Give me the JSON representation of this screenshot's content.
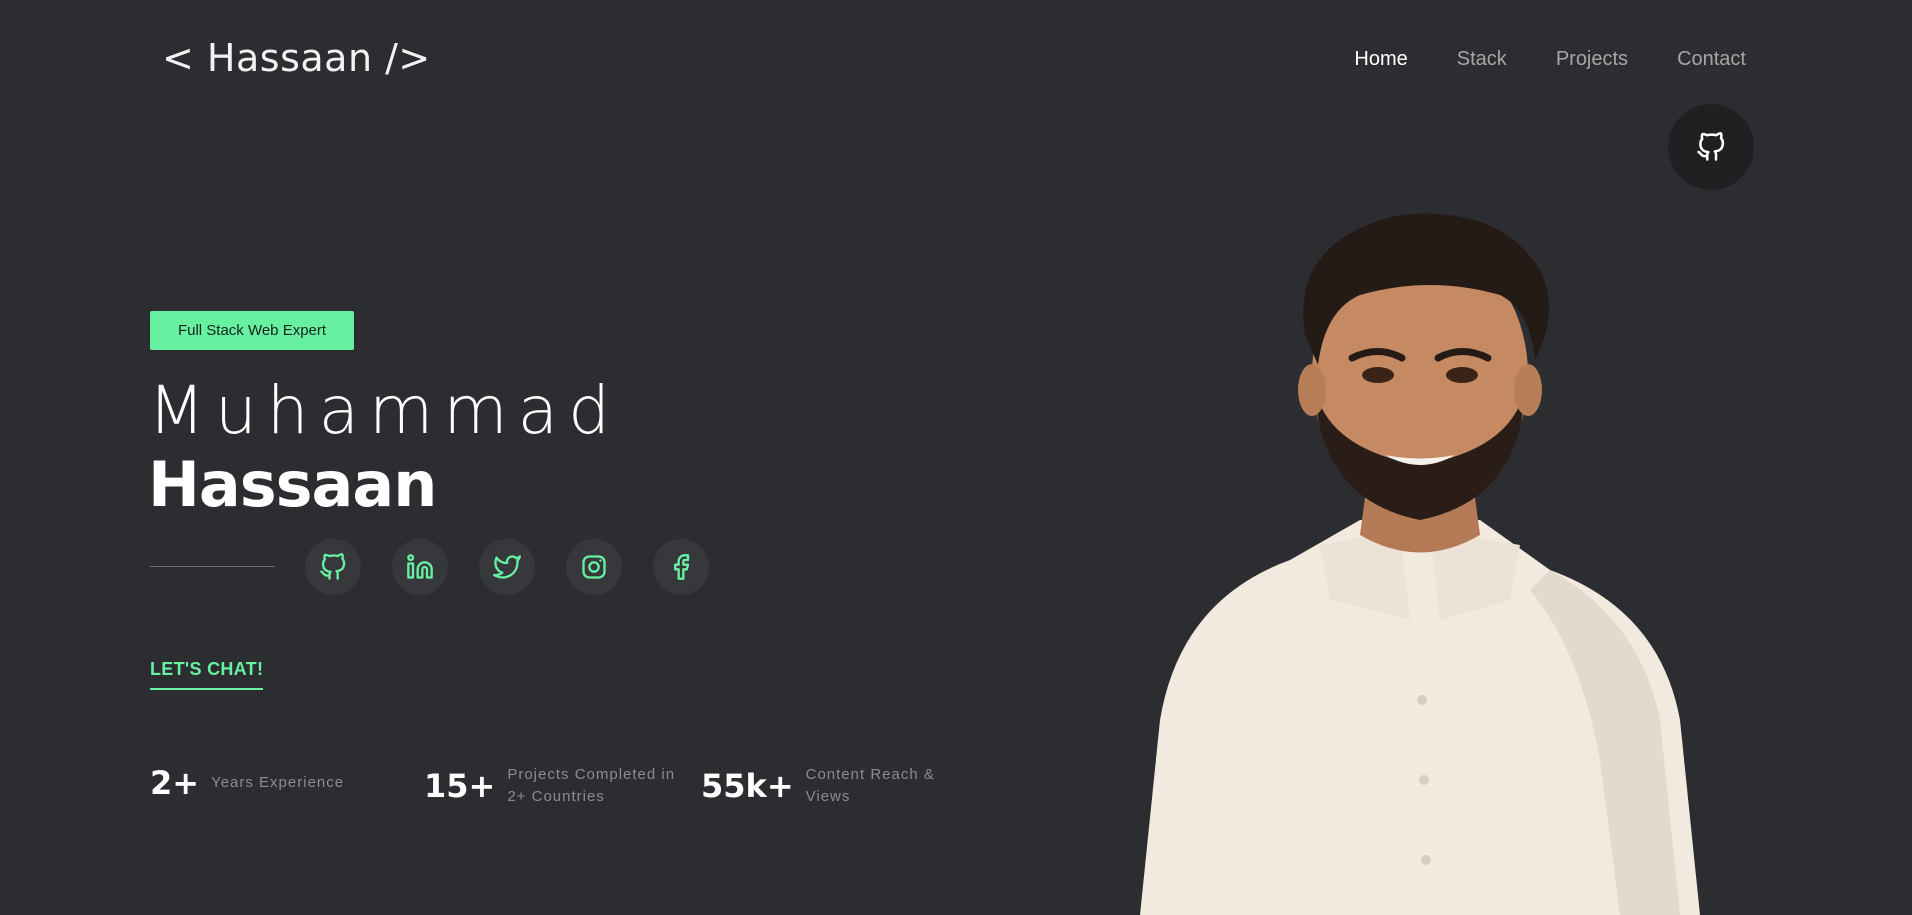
{
  "header": {
    "logo": "< Hassaan />",
    "nav": [
      "Home",
      "Stack",
      "Projects",
      "Contact"
    ],
    "github_icon": "github-icon"
  },
  "hero": {
    "badge": "Full Stack Web Expert",
    "first_name": "Muhammad",
    "last_name": "Hassaan",
    "socials": [
      "github-icon",
      "linkedin-icon",
      "twitter-icon",
      "instagram-icon",
      "facebook-icon"
    ],
    "cta": "LET'S CHAT!"
  },
  "stats": [
    {
      "value": "2+",
      "label_line1": "Years Experience",
      "label_line2": ""
    },
    {
      "value": "15+",
      "label_line1": "Projects Completed in",
      "label_line2": "2+ Countries"
    },
    {
      "value": "55k+",
      "label_line1": "Content Reach &",
      "label_line2": "Views"
    }
  ],
  "colors": {
    "background": "#2b2d31",
    "accent": "#67f0a2",
    "muted_text": "#8a8c91"
  }
}
